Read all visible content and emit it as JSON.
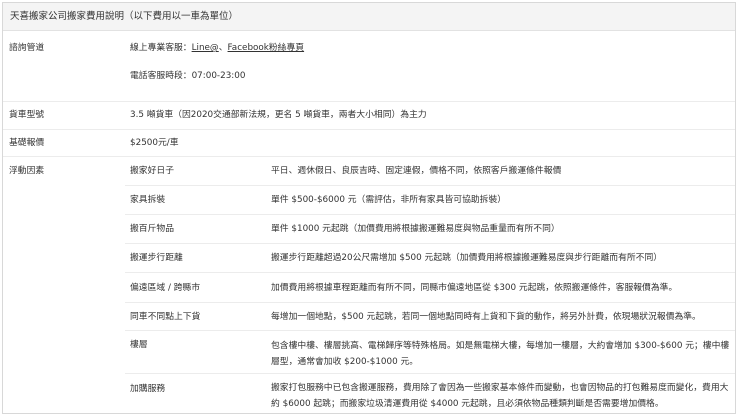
{
  "caption": "天喜搬家公司搬家費用說明（以下費用以一車為單位）",
  "consult": {
    "label": "諮詢管道",
    "prefix": "線上專業客服：",
    "line_link": "Line@",
    "comma": "、",
    "fb_link": "Facebook粉絲專頁",
    "phone_hours": "電話客服時段：07:00-23:00"
  },
  "truck": {
    "label": "貨車型號",
    "value": "3.5 噸貨車（因2020交通部新法規，更名 5 噸貨車，兩者大小相同）為主力"
  },
  "base_price": {
    "label": "基礎報價",
    "value": "$2500元/車"
  },
  "floating": {
    "label": "浮動因素",
    "items": [
      {
        "name": "搬家好日子",
        "desc": "平日、週休假日、良辰吉時、固定連假，價格不同，依照客戶搬運條件報價"
      },
      {
        "name": "家具拆裝",
        "desc": "單件 $500-$6000 元（需評估，非所有家具皆可協助拆裝）"
      },
      {
        "name": "搬百斤物品",
        "desc": "單件 $1000 元起跳（加價費用將根據搬運難易度與物品重量而有所不同）"
      },
      {
        "name": "搬運步行距離",
        "desc": "搬運步行距離超過20公尺需增加 $500 元起跳（加價費用將根據搬運難易度與步行距離而有所不同）"
      },
      {
        "name": "偏遠區域 / 跨縣市",
        "desc": "加價費用將根據車程距離而有所不同，同縣市偏遠地區從 $300 元起跳，依照搬運條件，客服報價為準。"
      },
      {
        "name": "同車不同點上下貨",
        "desc": "每增加一個地點，$500 元起跳，若同一個地點同時有上貨和下貨的動作，將另外計費，依現場狀況報價為準。"
      },
      {
        "name": "樓層",
        "desc": "包含樓中樓、樓層挑高、電梯歸序等特殊格局。如是無電梯大樓，每增加一樓層，大約會增加 $300-$600 元；樓中樓層型，通常會加收 $200-$1000 元。"
      },
      {
        "name": "加購服務",
        "desc": "搬家打包服務中已包含搬運服務，費用除了會因為一些搬家基本條件而變動，也會因物品的打包難易度而變化，費用大約 $6000 起跳；而搬家垃圾清運費用從 $4000 元起跳，且必須依物品種類判斷是否需要增加價格。"
      }
    ]
  }
}
